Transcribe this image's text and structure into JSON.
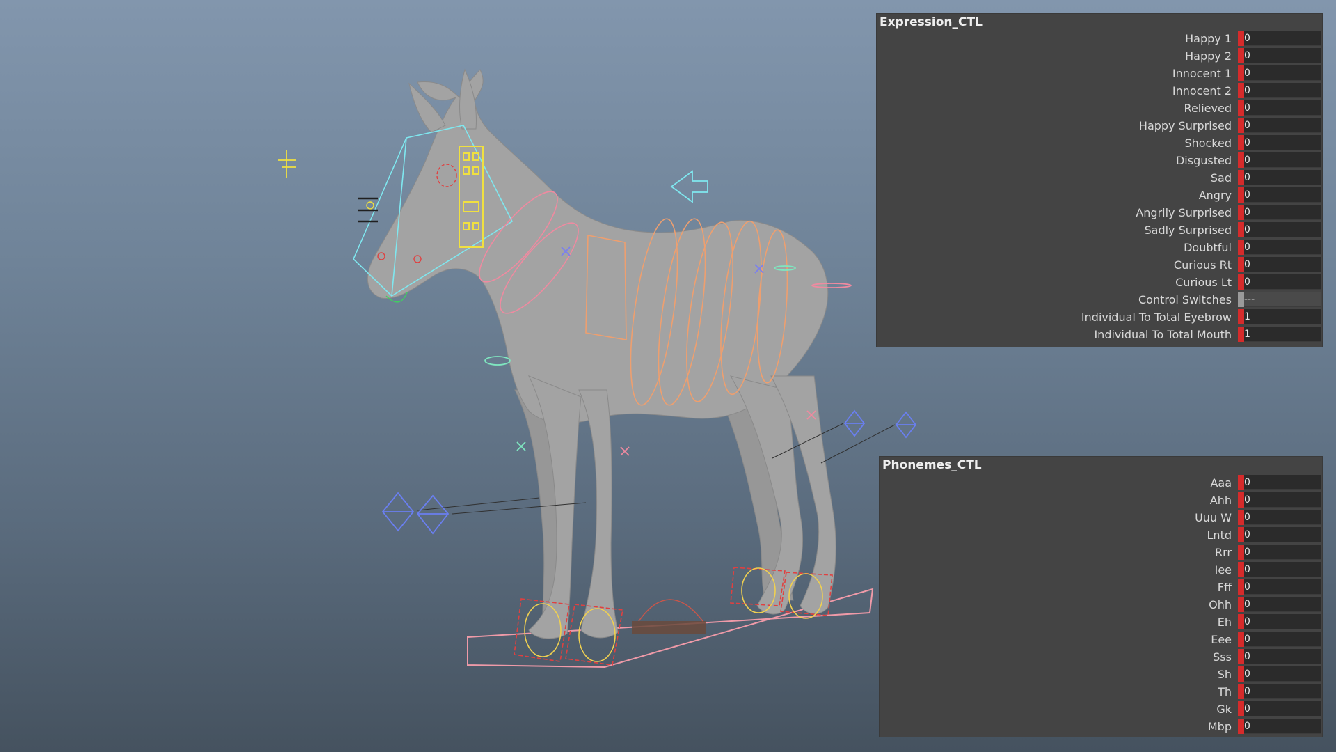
{
  "colors": {
    "keyed": "#d52b2b",
    "separator": "#9a9a9a",
    "panel_bg": "#444444",
    "field_bg": "#2b2b2b"
  },
  "expression_panel": {
    "title": "Expression_CTL",
    "attributes": [
      {
        "label": "Happy 1",
        "value": "0",
        "state": "keyed"
      },
      {
        "label": "Happy 2",
        "value": "0",
        "state": "keyed"
      },
      {
        "label": "Innocent 1",
        "value": "0",
        "state": "keyed"
      },
      {
        "label": "Innocent 2",
        "value": "0",
        "state": "keyed"
      },
      {
        "label": "Relieved",
        "value": "0",
        "state": "keyed"
      },
      {
        "label": "Happy Surprised",
        "value": "0",
        "state": "keyed"
      },
      {
        "label": "Shocked",
        "value": "0",
        "state": "keyed"
      },
      {
        "label": "Disgusted",
        "value": "0",
        "state": "keyed"
      },
      {
        "label": "Sad",
        "value": "0",
        "state": "keyed"
      },
      {
        "label": "Angry",
        "value": "0",
        "state": "keyed"
      },
      {
        "label": "Angrily Surprised",
        "value": "0",
        "state": "keyed"
      },
      {
        "label": "Sadly Surprised",
        "value": "0",
        "state": "keyed"
      },
      {
        "label": "Doubtful",
        "value": "0",
        "state": "keyed"
      },
      {
        "label": "Curious Rt",
        "value": "0",
        "state": "keyed"
      },
      {
        "label": "Curious Lt",
        "value": "0",
        "state": "keyed"
      },
      {
        "label": "Control Switches",
        "value": "---",
        "state": "separator"
      },
      {
        "label": "Individual To Total Eyebrow",
        "value": "1",
        "state": "keyed"
      },
      {
        "label": "Individual To Total Mouth",
        "value": "1",
        "state": "keyed"
      }
    ]
  },
  "phonemes_panel": {
    "title": "Phonemes_CTL",
    "attributes": [
      {
        "label": "Aaa",
        "value": "0",
        "state": "keyed"
      },
      {
        "label": "Ahh",
        "value": "0",
        "state": "keyed"
      },
      {
        "label": "Uuu W",
        "value": "0",
        "state": "keyed"
      },
      {
        "label": "Lntd",
        "value": "0",
        "state": "keyed"
      },
      {
        "label": "Rrr",
        "value": "0",
        "state": "keyed"
      },
      {
        "label": "Iee",
        "value": "0",
        "state": "keyed"
      },
      {
        "label": "Fff",
        "value": "0",
        "state": "keyed"
      },
      {
        "label": "Ohh",
        "value": "0",
        "state": "keyed"
      },
      {
        "label": "Eh",
        "value": "0",
        "state": "keyed"
      },
      {
        "label": "Eee",
        "value": "0",
        "state": "keyed"
      },
      {
        "label": "Sss",
        "value": "0",
        "state": "keyed"
      },
      {
        "label": "Sh",
        "value": "0",
        "state": "keyed"
      },
      {
        "label": "Th",
        "value": "0",
        "state": "keyed"
      },
      {
        "label": "Gk",
        "value": "0",
        "state": "keyed"
      },
      {
        "label": "Mbp",
        "value": "0",
        "state": "keyed"
      }
    ]
  },
  "viewport": {
    "subject": "horse-rig"
  }
}
